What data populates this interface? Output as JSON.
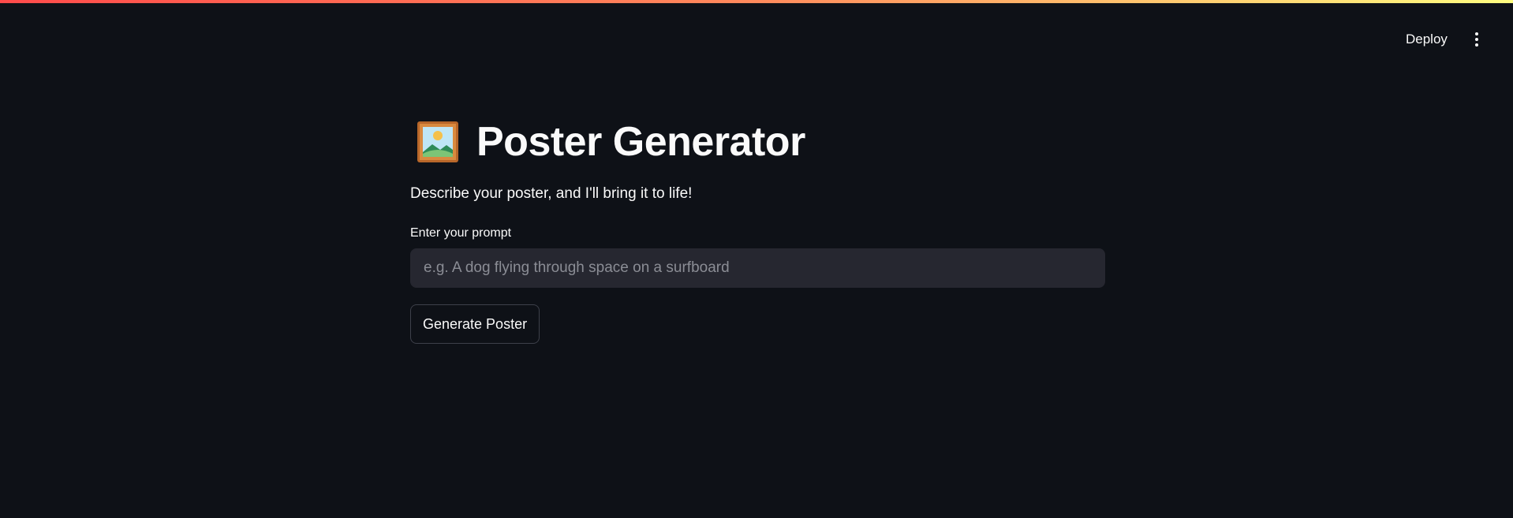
{
  "header": {
    "deploy_label": "Deploy",
    "menu_icon": "vertical-ellipsis-icon"
  },
  "main": {
    "title_icon": "framed-picture-icon",
    "title": "Poster Generator",
    "subtitle": "Describe your poster, and I'll bring it to life!",
    "prompt": {
      "label": "Enter your prompt",
      "value": "",
      "placeholder": "e.g. A dog flying through space on a surfboard"
    },
    "generate_label": "Generate Poster"
  },
  "colors": {
    "background": "#0e1117",
    "input_background": "#262730",
    "text": "#fafafa",
    "placeholder": "#8b8d95",
    "accent_gradient": [
      "#ff4b4b",
      "#fffd80"
    ]
  }
}
